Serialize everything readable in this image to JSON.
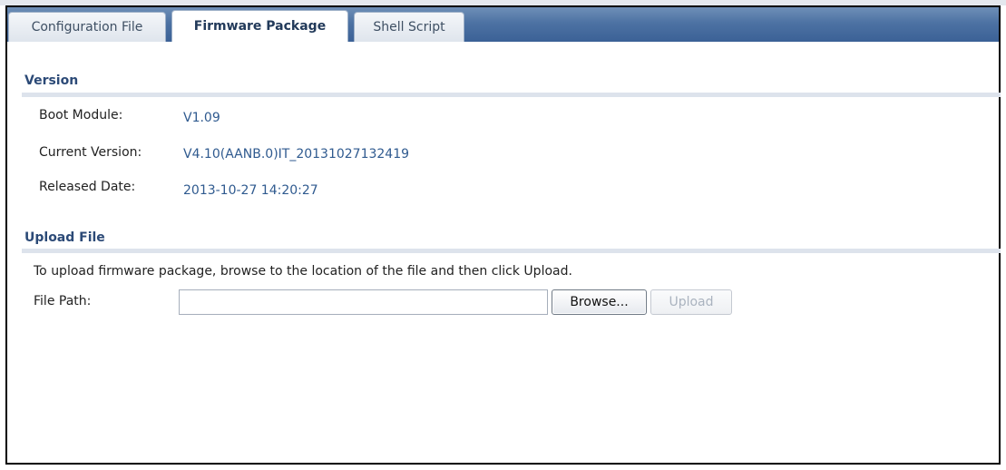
{
  "tabs": [
    {
      "label": "Configuration File",
      "active": false
    },
    {
      "label": "Firmware Package",
      "active": true
    },
    {
      "label": "Shell Script",
      "active": false
    }
  ],
  "version_section": {
    "title": "Version",
    "rows": [
      {
        "label": "Boot Module:",
        "value": "V1.09"
      },
      {
        "label": "Current Version:",
        "value": "V4.10(AANB.0)IT_20131027132419"
      },
      {
        "label": "Released Date:",
        "value": "2013-10-27 14:20:27"
      }
    ]
  },
  "upload_section": {
    "title": "Upload File",
    "instructions": "To upload firmware package, browse to the location of the file and then click Upload.",
    "file_path_label": "File Path:",
    "file_path_value": "",
    "browse_label": "Browse...",
    "upload_label": "Upload",
    "upload_enabled": false
  },
  "colors": {
    "tab_bar": "#4d72a3",
    "section_title": "#2c4a77",
    "value_text": "#2f5a8f",
    "section_rule": "#dde3ec"
  }
}
